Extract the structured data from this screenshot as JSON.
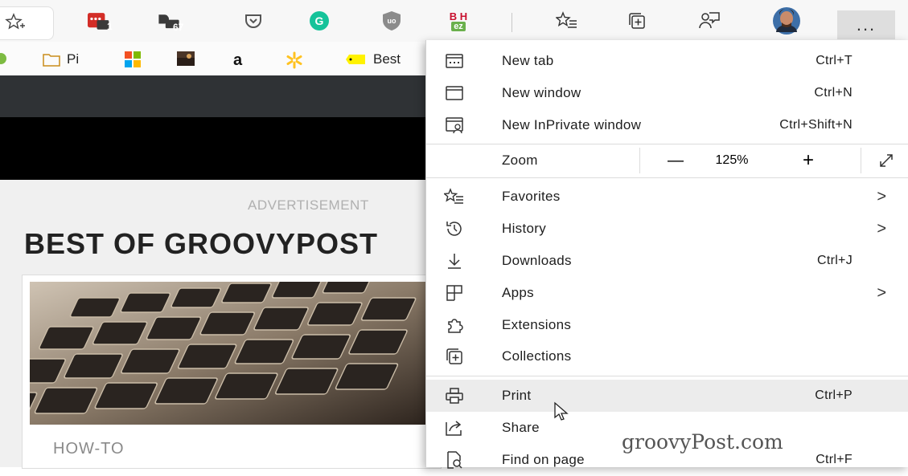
{
  "toolbar": {
    "extension_badges": [
      "1",
      "67"
    ],
    "icons": [
      "favorite-add-icon",
      "lastpass-icon",
      "dashlane-icon",
      "pocket-icon",
      "grammarly-icon",
      "ublock-icon",
      "bh-icon",
      "favorites-icon",
      "collections-icon",
      "feedback-icon",
      "profile-avatar",
      "more-icon"
    ],
    "bh_label": "B H",
    "bh_sub": "ez",
    "more_label": "..."
  },
  "bookmarks": {
    "items": [
      {
        "label": "Pi",
        "icon": "folder-icon"
      },
      {
        "label": "",
        "icon": "microsoft-icon"
      },
      {
        "label": "",
        "icon": "photo-icon"
      },
      {
        "label": "a",
        "icon": "amazon-icon"
      },
      {
        "label": "",
        "icon": "walmart-icon"
      },
      {
        "label": "Best",
        "icon": "bestbuy-icon"
      }
    ]
  },
  "page": {
    "advertisement": "ADVERTISEMENT",
    "heading": "BEST OF GROOVYPOST",
    "category": "HOW-TO"
  },
  "menu": {
    "items": [
      {
        "label": "New tab",
        "shortcut": "Ctrl+T",
        "icon": "new-tab-icon"
      },
      {
        "label": "New window",
        "shortcut": "Ctrl+N",
        "icon": "new-window-icon"
      },
      {
        "label": "New InPrivate window",
        "shortcut": "Ctrl+Shift+N",
        "icon": "inprivate-icon"
      },
      {
        "label": "Favorites",
        "shortcut": "",
        "icon": "favorites-icon"
      },
      {
        "label": "History",
        "shortcut": "",
        "icon": "history-icon"
      },
      {
        "label": "Downloads",
        "shortcut": "Ctrl+J",
        "icon": "download-icon"
      },
      {
        "label": "Apps",
        "shortcut": "",
        "icon": "apps-icon"
      },
      {
        "label": "Extensions",
        "shortcut": "",
        "icon": "extensions-icon"
      },
      {
        "label": "Collections",
        "shortcut": "",
        "icon": "collections-icon"
      },
      {
        "label": "Print",
        "shortcut": "Ctrl+P",
        "icon": "print-icon"
      },
      {
        "label": "Share",
        "shortcut": "",
        "icon": "share-icon"
      },
      {
        "label": "Find on page",
        "shortcut": "Ctrl+F",
        "icon": "find-icon"
      }
    ],
    "zoom": {
      "label": "Zoom",
      "value": "125%",
      "minus": "—",
      "plus": "+"
    },
    "submenu_arrow": ">"
  },
  "watermark": "groovyPost.com",
  "colors": {
    "lastpass": "#d32d27",
    "grammarly": "#15c39a",
    "menu_highlight": "#ececec",
    "amazon": "#ff9900",
    "walmart": "#ffc220"
  }
}
